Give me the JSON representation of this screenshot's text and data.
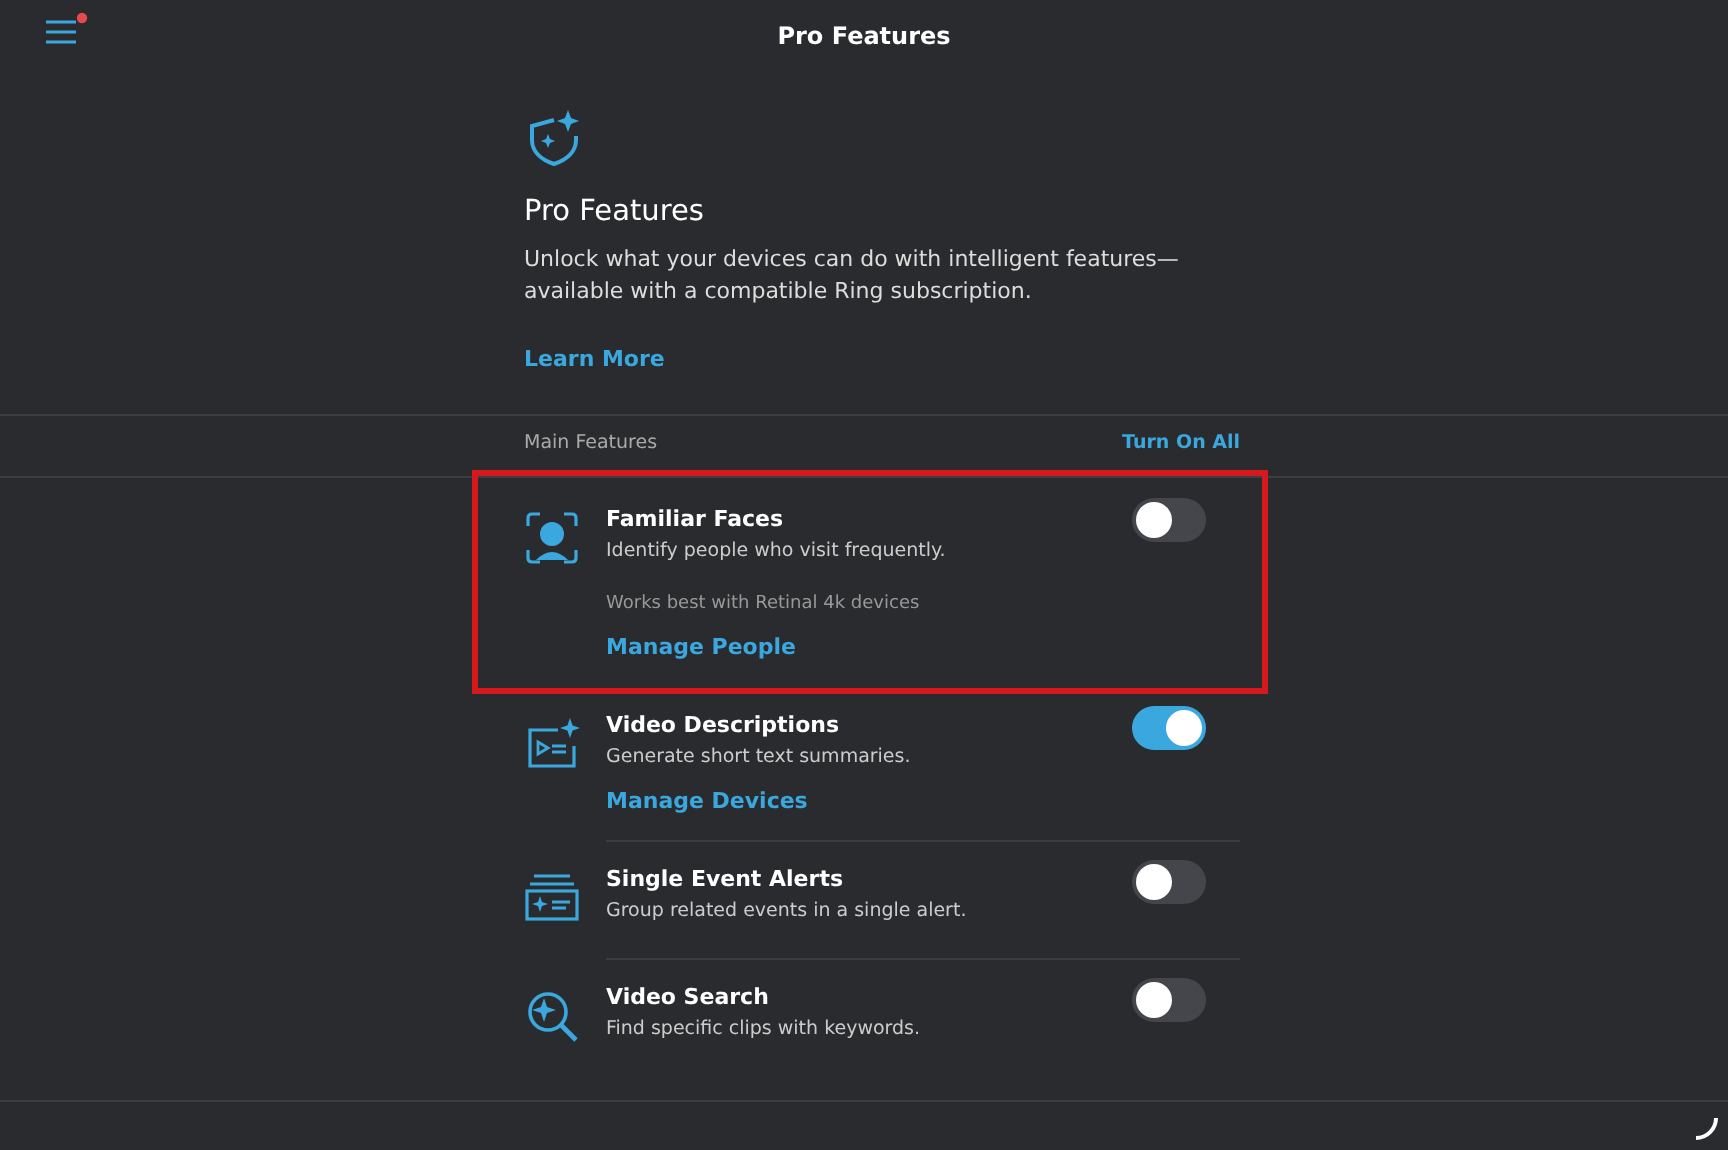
{
  "top_bar": {
    "title": "Pro Features",
    "menu_badge": true
  },
  "intro": {
    "title": "Pro Features",
    "description": "Unlock what your devices can do with intelligent features—available with a compatible Ring subscription.",
    "link": "Learn More"
  },
  "section": {
    "label": "Main Features",
    "action": "Turn On All"
  },
  "features": [
    {
      "title": "Familiar Faces",
      "description": "Identify people who visit frequently.",
      "note": "Works best with Retinal 4k devices",
      "link": "Manage People",
      "on": false,
      "highlighted": true
    },
    {
      "title": "Video Descriptions",
      "description": "Generate short text summaries.",
      "link": "Manage Devices",
      "on": true,
      "highlighted": false
    },
    {
      "title": "Single Event Alerts",
      "description": "Group related events in a single alert.",
      "on": false,
      "highlighted": false
    },
    {
      "title": "Video Search",
      "description": "Find specific clips with keywords.",
      "on": false,
      "highlighted": false
    }
  ]
}
